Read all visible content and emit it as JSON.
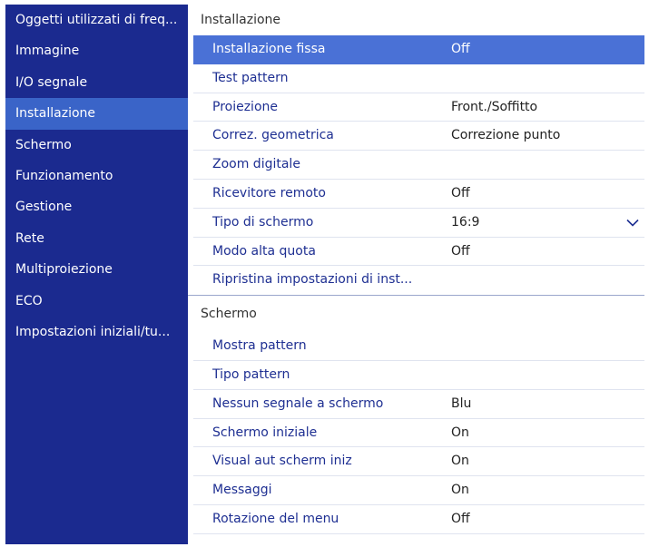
{
  "sidebar": {
    "items": [
      {
        "label": "Oggetti utilizzati di freq..."
      },
      {
        "label": "Immagine"
      },
      {
        "label": "I/O segnale"
      },
      {
        "label": "Installazione"
      },
      {
        "label": "Schermo"
      },
      {
        "label": "Funzionamento"
      },
      {
        "label": "Gestione"
      },
      {
        "label": "Rete"
      },
      {
        "label": "Multiproiezione"
      },
      {
        "label": "ECO"
      },
      {
        "label": "Impostazioni iniziali/tu..."
      }
    ],
    "active": "Installazione"
  },
  "main": {
    "sections": [
      {
        "title": "Installazione",
        "rows": [
          {
            "label": "Installazione fissa",
            "value": "Off",
            "selected": true
          },
          {
            "label": "Test pattern",
            "value": ""
          },
          {
            "label": "Proiezione",
            "value": "Front./Soffitto"
          },
          {
            "label": "Correz. geometrica",
            "value": "Correzione punto"
          },
          {
            "label": "Zoom digitale",
            "value": ""
          },
          {
            "label": "Ricevitore remoto",
            "value": "Off"
          },
          {
            "label": "Tipo di schermo",
            "value": "16:9",
            "icon": "chevron-down-icon"
          },
          {
            "label": "Modo alta quota",
            "value": "Off"
          },
          {
            "label": "Ripristina impostazioni di inst...",
            "value": ""
          }
        ]
      },
      {
        "title": "Schermo",
        "rows": [
          {
            "label": "Mostra pattern",
            "value": ""
          },
          {
            "label": "Tipo pattern",
            "value": ""
          },
          {
            "label": "Nessun segnale a schermo",
            "value": "Blu"
          },
          {
            "label": "Schermo iniziale",
            "value": "On"
          },
          {
            "label": "Visual aut scherm iniz",
            "value": "On"
          },
          {
            "label": "Messaggi",
            "value": "On"
          },
          {
            "label": "Rotazione del menu",
            "value": "Off"
          }
        ]
      }
    ]
  },
  "colors": {
    "sidebar_bg": "#1b2a8f",
    "sidebar_active": "#3a64c8",
    "row_selected": "#4a71d6",
    "label_text": "#1e2f92"
  }
}
